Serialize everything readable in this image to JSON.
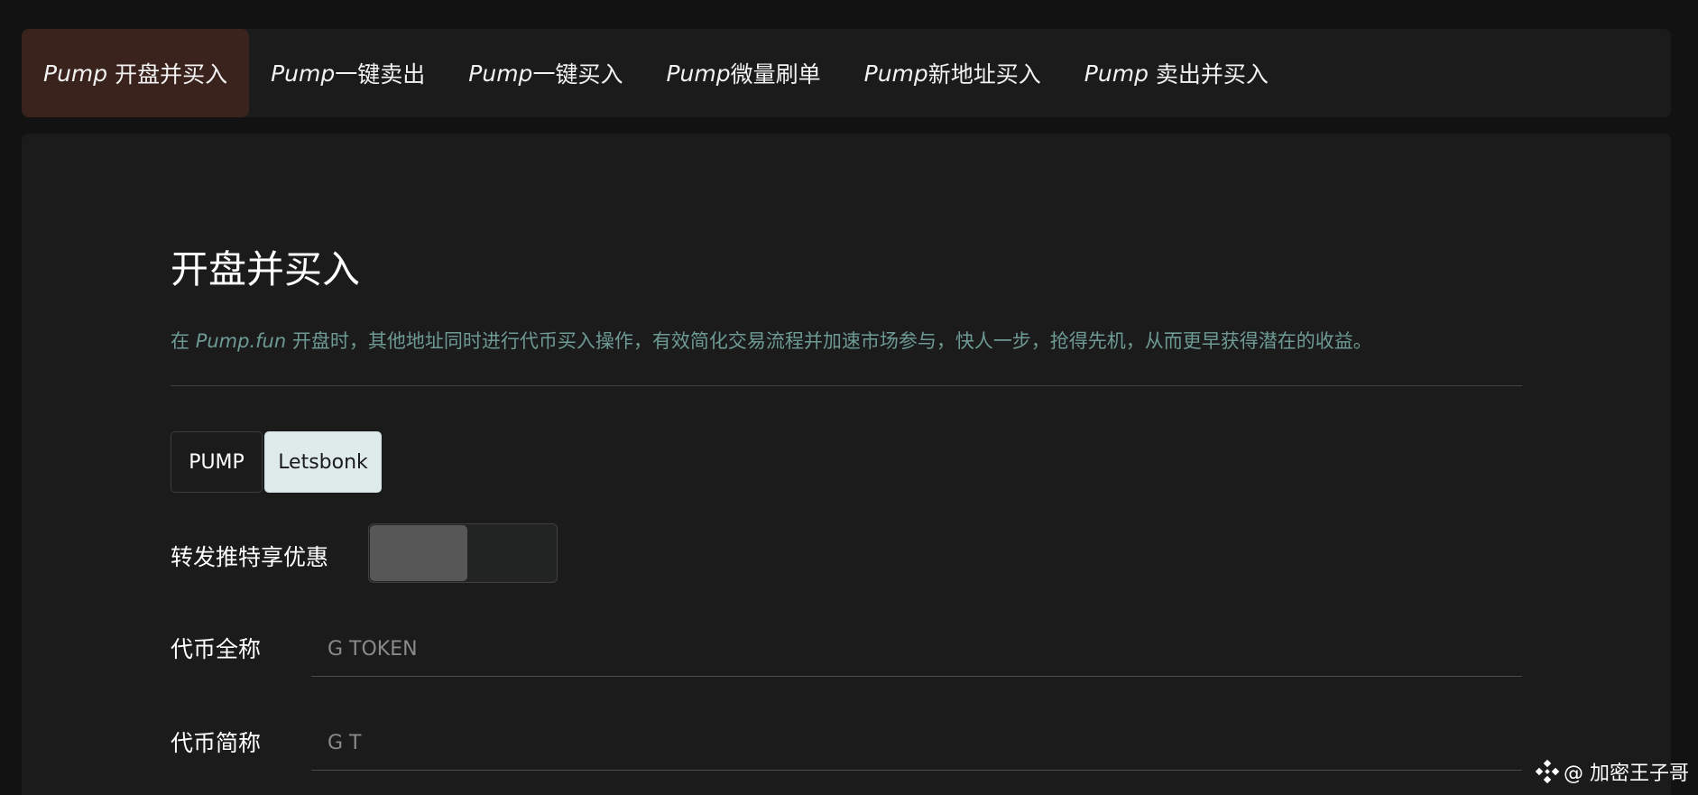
{
  "tabs": [
    {
      "italic": "Pump",
      "text": " 开盘并买入",
      "active": true
    },
    {
      "italic": "Pump",
      "text": "一键卖出",
      "active": false
    },
    {
      "italic": "Pump",
      "text": "一键买入",
      "active": false
    },
    {
      "italic": "Pump",
      "text": "微量刷单",
      "active": false
    },
    {
      "italic": "Pump",
      "text": "新地址买入",
      "active": false
    },
    {
      "italic": "Pump",
      "text": " 卖出并买入",
      "active": false
    }
  ],
  "main": {
    "title": "开盘并买入",
    "description": {
      "prefix": "在 ",
      "italic": "Pump.fun",
      "rest": " 开盘时，其他地址同时进行代币买入操作，有效简化交易流程并加速市场参与，快人一步，抢得先机，从而更早获得潜在的收益。"
    },
    "platform_options": {
      "pump": "PUMP",
      "bonk": "Letsbonk",
      "selected": "Letsbonk"
    },
    "share_discount": {
      "label": "转发推特享优惠",
      "enabled": false
    },
    "token_full_name": {
      "label": "代币全称",
      "placeholder": "G TOKEN"
    },
    "token_symbol": {
      "label": "代币简称",
      "placeholder": "G T"
    }
  },
  "watermark": {
    "text": "@ 加密王子哥",
    "icon": "binance-diamond-icon"
  },
  "colors": {
    "active_tab": "#3a221d",
    "description": "#6e9a94",
    "selected_option": "#dfeaea"
  }
}
